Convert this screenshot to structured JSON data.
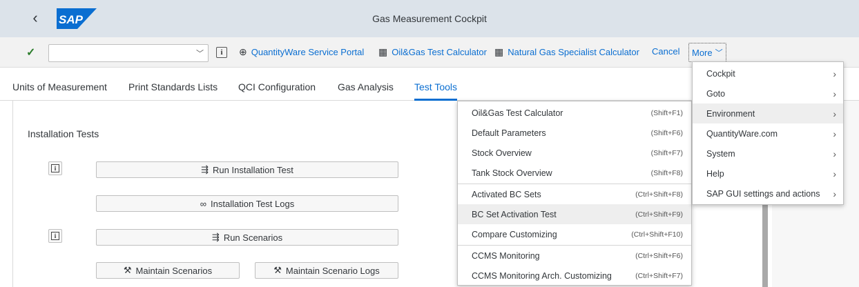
{
  "shell": {
    "back_glyph": "‹",
    "logo_text": "SAP",
    "title": "Gas Measurement Cockpit",
    "colors": {
      "logo": "#0a6ed1",
      "bar": "#dce3ea"
    }
  },
  "toolbar": {
    "command_value": "",
    "command_placeholder": "",
    "service_portal": "QuantityWare Service Portal",
    "test_calculator": "Oil&Gas Test Calculator",
    "ng_calculator": "Natural Gas Specialist Calculator",
    "cancel": "Cancel",
    "more": "More"
  },
  "tabs": [
    {
      "label": "Units of Measurement"
    },
    {
      "label": "Print Standards Lists"
    },
    {
      "label": "QCI Configuration"
    },
    {
      "label": "Gas Analysis"
    },
    {
      "label": "Test Tools"
    }
  ],
  "main": {
    "section_title": "Installation Tests",
    "buttons": {
      "run_installation_test": "Run Installation Test",
      "installation_test_logs": "Installation Test Logs",
      "run_scenarios": "Run Scenarios",
      "maintain_scenarios": "Maintain Scenarios",
      "maintain_scenario_logs": "Maintain Scenario Logs"
    }
  },
  "submenu": {
    "items": [
      {
        "label": "Oil&Gas Test Calculator",
        "shortcut": "(Shift+F1)"
      },
      {
        "label": "Default Parameters",
        "shortcut": "(Shift+F6)"
      },
      {
        "label": "Stock Overview",
        "shortcut": "(Shift+F7)"
      },
      {
        "label": "Tank Stock Overview",
        "shortcut": "(Shift+F8)"
      },
      {
        "label": "Activated BC Sets",
        "shortcut": "(Ctrl+Shift+F8)"
      },
      {
        "label": "BC Set Activation Test",
        "shortcut": "(Ctrl+Shift+F9)"
      },
      {
        "label": "Compare Customizing",
        "shortcut": "(Ctrl+Shift+F10)"
      },
      {
        "label": "CCMS Monitoring",
        "shortcut": "(Ctrl+Shift+F6)"
      },
      {
        "label": "CCMS Monitoring Arch. Customizing",
        "shortcut": "(Ctrl+Shift+F7)"
      }
    ]
  },
  "more_menu": {
    "items": [
      {
        "label": "Cockpit"
      },
      {
        "label": "Goto"
      },
      {
        "label": "Environment"
      },
      {
        "label": "QuantityWare.com"
      },
      {
        "label": "System"
      },
      {
        "label": "Help"
      },
      {
        "label": "SAP GUI settings and actions"
      }
    ]
  }
}
